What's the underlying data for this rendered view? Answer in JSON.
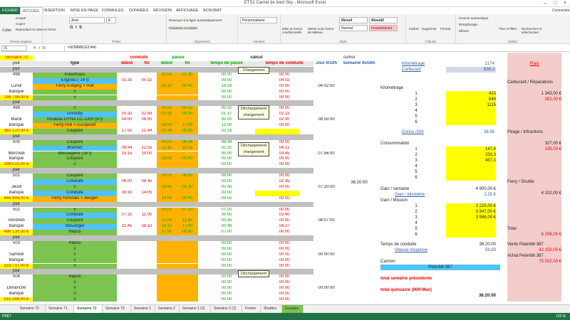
{
  "window": {
    "title": "ETS2 Carnet de bord Sky - Microsoft Excel"
  },
  "ribbon_tabs": [
    "FICHIER",
    "ACCUEIL",
    "INSERTION",
    "MISE EN PAGE",
    "FORMULES",
    "DONNÉES",
    "RÉVISION",
    "AFFICHAGE",
    "ACROBAT"
  ],
  "user": "Connexion",
  "ribbon": {
    "clipboard": {
      "paste": "Coller",
      "cut": "Couper",
      "copy": "Copier",
      "format": "Reproduire la mise en forme",
      "label": "Presse-papiers"
    },
    "font": {
      "name": "Arial",
      "size": "8",
      "label": "Police"
    },
    "alignment": {
      "wrap": "Renvoyer à la ligne automatiquement",
      "merge": "Fusionner et centrer",
      "label": "Alignement"
    },
    "number": {
      "format": "Personnalisée",
      "label": "Nombre"
    },
    "styles": {
      "cond": "Mise en forme conditionnelle",
      "table": "Mettre sous forme de tableau",
      "s1": "Résult",
      "s2": "Résult2",
      "s3": "Normal",
      "s4": "Insatisfaisant",
      "label": "Style"
    },
    "cells": {
      "insert": "Insérer",
      "delete": "Supprimer",
      "format": "Format",
      "label": "Cellules"
    },
    "editing": {
      "autosum": "Somme automatique",
      "fill": "Remplissage",
      "clear": "Effacer",
      "sort": "Trier et filtrer",
      "find": "Rechercher et sélectionner",
      "label": "Édition"
    }
  },
  "formula_bar": {
    "cell": "J1",
    "formula": "=SOMME(G3:I44)"
  },
  "headers": {
    "semaine": "Semaine 72",
    "conduite": "conduite",
    "pause": "pause",
    "calcul": "calcul",
    "cumul": "cumul",
    "jour": "jour",
    "type": "type",
    "debut": "debut",
    "fin": "fin",
    "debut2": "debut",
    "fin2": "fin",
    "temps_pause": "temps de pause",
    "temps_conduite": "temps de conduite",
    "jour_col": "Jour 9/10h",
    "semaine_col": "Semaine 45/56h"
  },
  "days": [
    {
      "num": "498",
      "name": "Lundi",
      "bank": "Banque",
      "money": "294 796,00 €",
      "total": "04:02:00",
      "rows": [
        [
          "Kolenhaus",
          "",
          "",
          "01:00",
          "01:30",
          "00:30",
          "00:00"
        ],
        [
          "Engines ( 14 t)",
          "01:30",
          "05:32",
          "",
          "",
          "00:00",
          "04:02"
        ],
        [
          "Ferry Esbjerg > Hull",
          "",
          "",
          "05:32",
          "00:00",
          "18:28",
          "00:00"
        ],
        [
          "v",
          "",
          "",
          "",
          "",
          "00:00",
          "00:00"
        ],
        [
          "v",
          "",
          "",
          "",
          "",
          "00:00",
          "00:00"
        ]
      ]
    },
    {
      "num": "499",
      "name": "Mardi",
      "bank": "Banque",
      "money": "362 220,00 €",
      "total": "08:55:00",
      "rows": [
        [
          "v",
          "",
          "",
          "00:00",
          "00:32",
          "00:32",
          "00:00"
        ],
        [
          "Grimsby",
          "00:32",
          "02:43",
          "02:43",
          "04:00",
          "01:17",
          "02:11"
        ],
        [
          "Rouleau DYNA CC-2200 (8 t)",
          "04:00",
          "06:00",
          "",
          "",
          "00:00",
          "02:00"
        ],
        [
          "Ferry Hull > Europoort",
          "",
          "",
          "06:00",
          "17:00",
          "11:00",
          "00:00"
        ],
        [
          "Coupure",
          "17:00",
          "21:44",
          "21:44",
          "00:00",
          "02:16",
          "04:44"
        ]
      ]
    },
    {
      "num": "500",
      "name": "Mercredi",
      "bank": "Banque",
      "money": "398 515,00 €",
      "total": "07:56:00",
      "rows": [
        [
          "Coupure",
          "",
          "",
          "00:00",
          "08:44",
          "08:44",
          "00:00"
        ],
        [
          "Bremen",
          "08:44",
          "12:55",
          "12:15",
          "15:15",
          "02:20",
          "04:11"
        ],
        [
          "Messagerie (18 t)",
          "15:15",
          "19:00",
          "",
          "",
          "00:00",
          "03:45"
        ],
        [
          "Coupure",
          "",
          "",
          "19:00",
          "00:00",
          "05:00",
          "00:00"
        ],
        [
          "v",
          "",
          "",
          "",
          "",
          "00:00",
          "00:00"
        ]
      ]
    },
    {
      "num": "501",
      "name": "Jeudi",
      "bank": "Banque",
      "money": "445 899,00 €",
      "total": "07:20:00",
      "rows": [
        [
          "Coupure",
          "",
          "",
          "00:00",
          "06:00",
          "06:00",
          "00:00"
        ],
        [
          "Conduite",
          "06:00",
          "08:45",
          "",
          "",
          "00:00",
          "02:45"
        ],
        [
          "v",
          "",
          "",
          "08:45",
          "09:30",
          "00:45",
          "00:00"
        ],
        [
          "Conduite",
          "09:30",
          "14:05",
          "",
          "",
          "00:00",
          "04:35"
        ],
        [
          "Ferry Hirtshals > Bergen",
          "",
          "",
          "14:05",
          "00:00",
          "09:55",
          "00:00"
        ]
      ]
    },
    {
      "num": "502",
      "name": "Vendredi",
      "bank": "Banque",
      "money": "486 130,00 €",
      "total": "08:07:00",
      "rows": [
        [
          "v",
          "",
          "",
          "00:00",
          "07:20",
          "07:20",
          "00:00"
        ],
        [
          "Conduite",
          "07:20",
          "11:00",
          "",
          "",
          "00:00",
          "03:40"
        ],
        [
          "Coupure",
          "",
          "",
          "11:00",
          "11:45",
          "00:45",
          "00:00"
        ],
        [
          "Stavanger",
          "11:45",
          "16:12",
          "15:12",
          "17:00",
          "00:48",
          "04:27"
        ],
        [
          "Repos",
          "",
          "",
          "17:00",
          "00:00",
          "07:00",
          "00:00"
        ]
      ]
    },
    {
      "num": "503",
      "name": "Samedi",
      "bank": "Banque",
      "money": "518 737,00 €",
      "total": "00:00:00",
      "rows": [
        [
          "Repos",
          "",
          "",
          "",
          "",
          "00:00",
          "00:00"
        ],
        [
          "v",
          "",
          "",
          "",
          "",
          "00:00",
          "00:00"
        ],
        [
          "v",
          "",
          "",
          "",
          "",
          "00:00",
          "00:00"
        ],
        [
          "v",
          "",
          "",
          "",
          "",
          "00:00",
          "00:00"
        ],
        [
          "v",
          "",
          "",
          "",
          "",
          "00:00",
          "00:00"
        ]
      ]
    },
    {
      "num": "504",
      "name": "Dimanche",
      "bank": "Banque",
      "money": "515 288,00 €",
      "total": "00:00:00",
      "rows": [
        [
          "Repos",
          "",
          "",
          "",
          "",
          "00:00",
          "00:00"
        ],
        [
          "v",
          "",
          "",
          "",
          "",
          "00:00",
          "00:00"
        ],
        [
          "v",
          "",
          "",
          "",
          "",
          "00:00",
          "00:00"
        ],
        [
          "v",
          "",
          "",
          "",
          "",
          "00:00",
          "00:00"
        ],
        [
          "v",
          "",
          "",
          "",
          "",
          "00:00",
          "00:00"
        ]
      ]
    }
  ],
  "week_total": "36:20:00",
  "notes": [
    "Chargement",
    "Déchargement chargement",
    "Déchargement chargement",
    "Déchargement"
  ],
  "stats": {
    "kilometrage": "Kilométrage",
    "kilometrage_val": "2174",
    "carburant": "Carburant",
    "carburant_val": "838,2",
    "km_title": "Kilométrage",
    "km": [
      "410",
      "649",
      "1115",
      "",
      "",
      ""
    ],
    "conso": "Conso /100",
    "conso_val": "38,56",
    "consommation": "Consommation",
    "conso_list": [
      "147,9",
      "233,3",
      "457,0",
      "",
      "",
      ""
    ],
    "gain_sem": "Gain / semaine",
    "gain_sem_val": "4 900,00 €",
    "gain_km": "Gain / kilomètre",
    "gain_km_val": "2,25 €",
    "gain_mission": "Gain / Mission",
    "missions": [
      "3 225,00 €",
      "3 947,00 €",
      "3 986,00 €",
      "",
      "",
      ""
    ],
    "temps": "Temps de conduite",
    "temps_val": "36:20:00",
    "vitesse": "Vitesse moyenne",
    "vitesse_val": "59,83",
    "camion": "Camion",
    "camion_val": "Peterbilt 387",
    "prev": "total semaine précédente",
    "quinz": "total quinzaine (90H Max)",
    "quinz_val": "36:20:00",
    "nums": [
      "1",
      "2",
      "3",
      "4",
      "5",
      "6"
    ]
  },
  "frais": {
    "title": "Frais",
    "carb": "Carburant / Réparations",
    "carb1": "1 343,00 €",
    "carb2": "351,00 €",
    "peage": "Péage / Infractions",
    "peage1": "327,00 €",
    "peage2": "135,00 €",
    "ferry": "Ferry / Shuttle",
    "ferry1": "4 102,00 €",
    "total": "Total",
    "total_val": "6 258,00 €",
    "vente": "Vente Peterbilt 387",
    "vente_val": "42 153,00 €",
    "achat": "Achat Peterbilt 387",
    "achat_val": "75 022,00 €"
  },
  "sheet_tabs": [
    "Semaine 70",
    "Semaine 71",
    "Semaine 72",
    "Semaine 73",
    "Semaine 1",
    "Semaine 2",
    "Semaine 1 (2)",
    "Semaine 2 (2)",
    "Ferries",
    "Shuttles",
    "Garages"
  ],
  "status": {
    "ready": "PRÊT",
    "zoom": "115 %"
  }
}
